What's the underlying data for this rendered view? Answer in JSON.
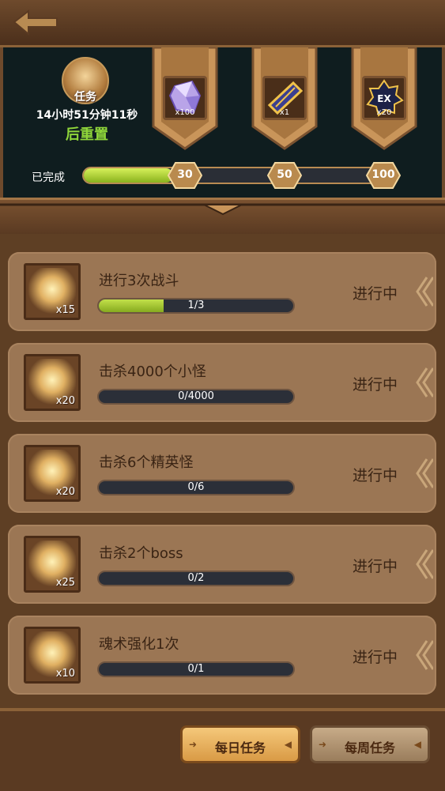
{
  "header": {
    "task_icon_label": "任务",
    "timer": "14小时51分钟11秒",
    "reset_label": "后重置",
    "completed_label": "已完成",
    "progress_fraction": 0.29,
    "milestones": [
      "30",
      "50",
      "100"
    ],
    "rewards": [
      {
        "icon": "crystal-icon",
        "count": "x100"
      },
      {
        "icon": "ticket-icon",
        "count": "x1"
      },
      {
        "icon": "ex-badge-icon",
        "count": "x20",
        "badge": "EX"
      }
    ]
  },
  "tasks": [
    {
      "title": "进行3次战斗",
      "progress": "1/3",
      "fraction": 0.333,
      "status": "进行中",
      "count": "x15"
    },
    {
      "title": "击杀4000个小怪",
      "progress": "0/4000",
      "fraction": 0,
      "status": "进行中",
      "count": "x20"
    },
    {
      "title": "击杀6个精英怪",
      "progress": "0/6",
      "fraction": 0,
      "status": "进行中",
      "count": "x20"
    },
    {
      "title": "击杀2个boss",
      "progress": "0/2",
      "fraction": 0,
      "status": "进行中",
      "count": "x25"
    },
    {
      "title": "魂术强化1次",
      "progress": "0/1",
      "fraction": 0,
      "status": "进行中",
      "count": "x10"
    }
  ],
  "tabs": {
    "daily": "每日任务",
    "weekly": "每周任务",
    "active": "daily"
  },
  "colors": {
    "accent_green": "#8fd63a",
    "card_bg": "#9b7654",
    "header_bg": "#0f1d1f"
  }
}
